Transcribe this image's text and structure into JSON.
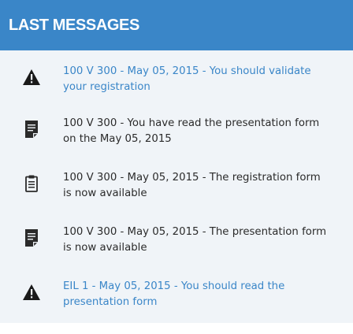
{
  "header": {
    "title": "LAST MESSAGES"
  },
  "colors": {
    "accent": "#3a86c8",
    "panel_bg": "#f0f4f8",
    "read_text": "#2b2b2b"
  },
  "messages": [
    {
      "icon": "warning-icon",
      "state": "unread",
      "text": "100 V 300 - May 05, 2015 - You should validate your registration"
    },
    {
      "icon": "document-icon",
      "state": "read",
      "text": "100 V 300 - You have read the presentation form on the May 05, 2015"
    },
    {
      "icon": "clipboard-icon",
      "state": "read",
      "text": "100 V 300 - May 05, 2015 - The registration form is now available"
    },
    {
      "icon": "document-icon",
      "state": "read",
      "text": "100 V 300 - May 05, 2015 - The presentation form is now available"
    },
    {
      "icon": "warning-icon",
      "state": "unread",
      "text": "EIL 1 - May 05, 2015 - You should read the presentation form"
    }
  ]
}
